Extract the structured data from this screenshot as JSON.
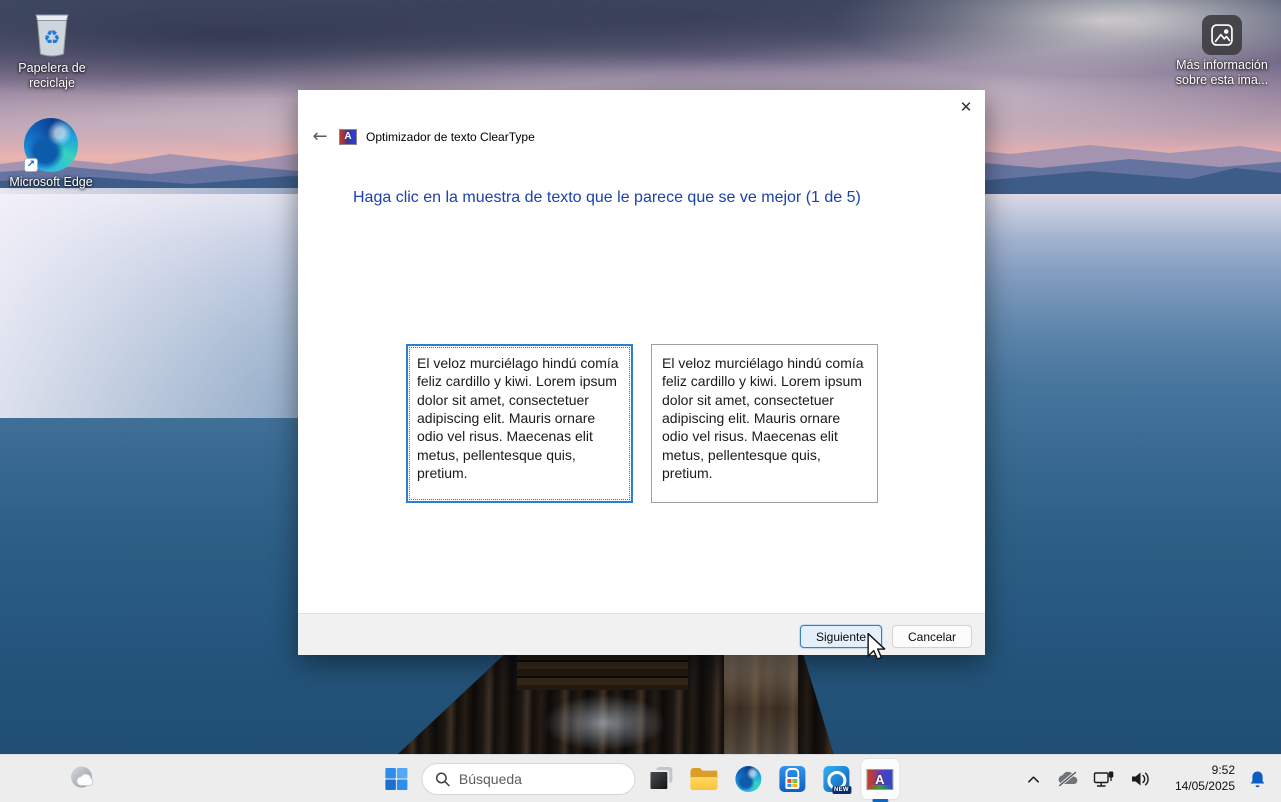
{
  "desktop": {
    "icons": [
      {
        "label": "Papelera de reciclaje"
      },
      {
        "label": "Microsoft Edge"
      },
      {
        "label": "Más información sobre esta ima..."
      }
    ]
  },
  "dialog": {
    "title": "Optimizador de texto ClearType",
    "heading": "Haga clic en la muestra de texto que le parece que se ve mejor (1 de 5)",
    "samples": [
      {
        "text": "El veloz murciélago hindú comía feliz cardillo y kiwi. Lorem ipsum dolor sit amet, consectetuer adipiscing elit. Mauris ornare odio vel risus. Maecenas elit metus, pellentesque quis, pretium.",
        "selected": true
      },
      {
        "text": "El veloz murciélago hindú comía feliz cardillo y kiwi. Lorem ipsum dolor sit amet, consectetuer adipiscing elit. Mauris ornare odio vel risus. Maecenas elit metus, pellentesque quis, pretium.",
        "selected": false
      }
    ],
    "buttons": {
      "next": "Siguiente",
      "cancel": "Cancelar"
    }
  },
  "taskbar": {
    "search_placeholder": "Búsqueda",
    "outlook_badge": "NEW",
    "tray": {
      "time": "9:52",
      "date": "14/05/2025"
    }
  },
  "glyphs": {
    "close": "✕",
    "back": "←",
    "shortcut_arrow": "↗",
    "recycle": "♻",
    "cleartype_letter": "A"
  },
  "colors": {
    "heading_blue": "#1b41ae",
    "selected_sample_border": "#2a7fd4",
    "taskbar_accent": "#0b66c3",
    "notification_bell": "#0b5cc4"
  }
}
